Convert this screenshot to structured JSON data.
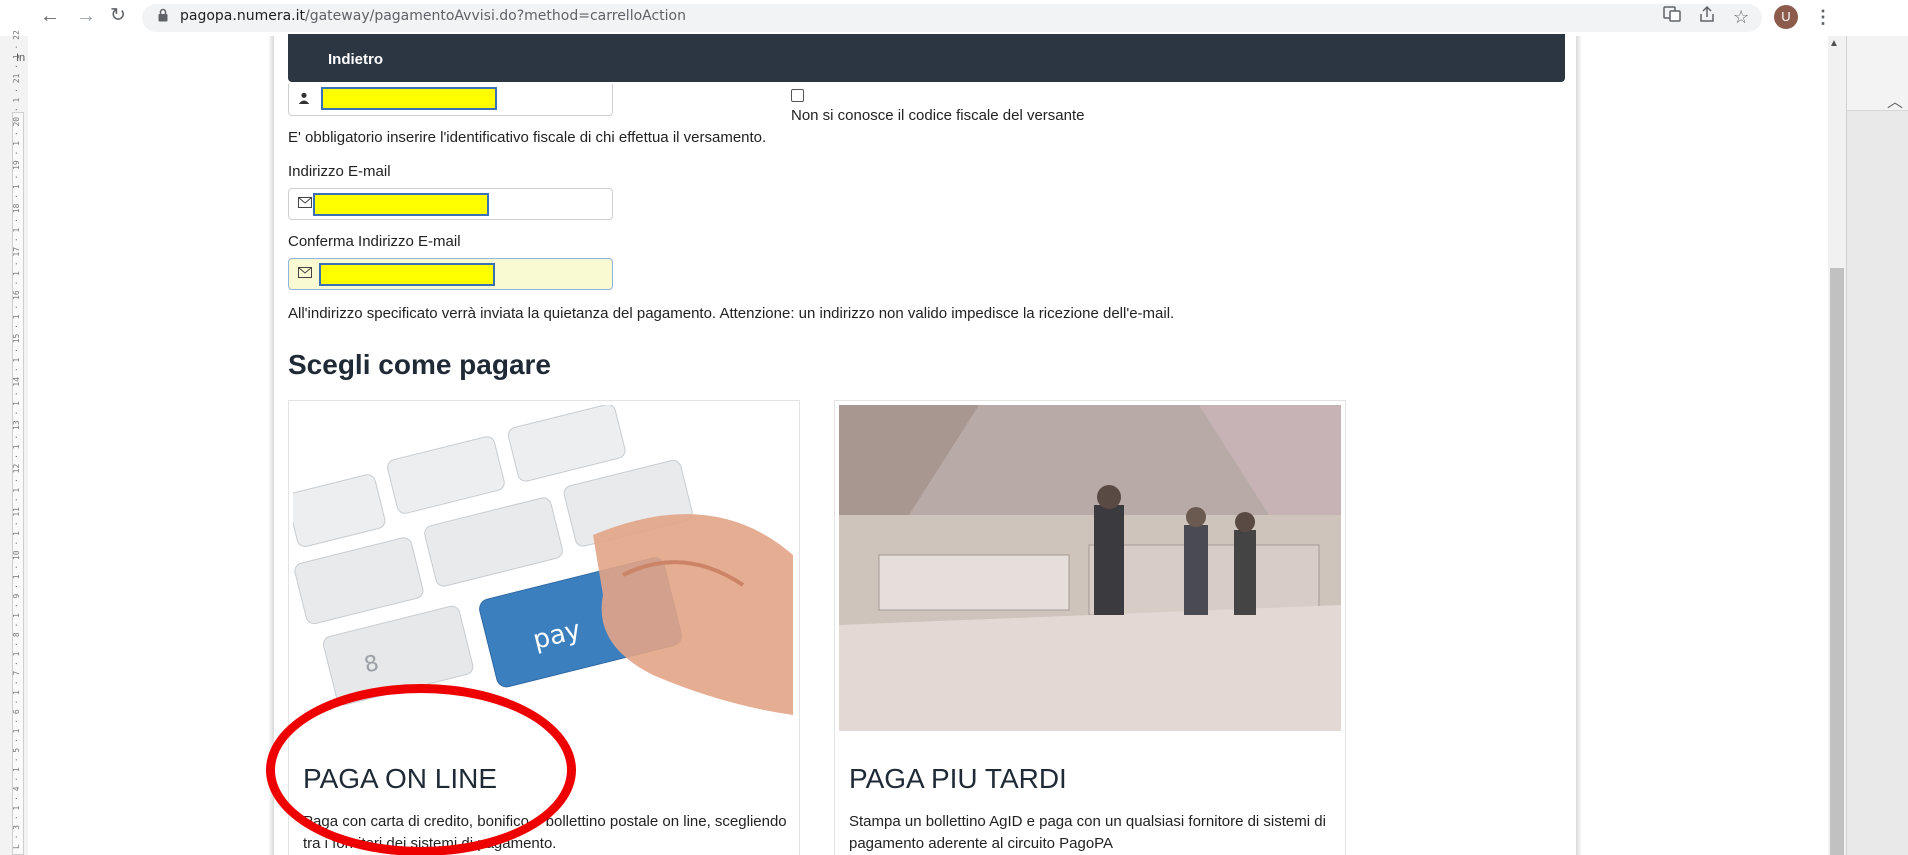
{
  "browser": {
    "url_host": "pagopa.numera.it",
    "url_path": "/gateway/pagamentoAvvisi.do?method=carrelloAction",
    "avatar_letter": "U",
    "icons": [
      "back-arrow-icon",
      "forward-arrow-icon",
      "reload-icon",
      "lock-icon",
      "translate-icon",
      "share-icon",
      "star-icon",
      "menu-dots-icon"
    ]
  },
  "background": {
    "left_fragment": "In",
    "ruler_text": "L · 3 · 1 · 4 · 1 · 5 · 1 · 6 · 1 · 7 · 1 · 8 · 1 · 9 · 1 · 10 · 1 · 11 · 1 · 12 · 1 · 13 · 1 · 14 · 1 · 15 · 1 · 16 · 1 · 17 · 1 · 18 · 1 · 19 · 1 · 20 · 1 · 21 · 1 · 22"
  },
  "nav": {
    "back_label": "Indietro"
  },
  "form": {
    "cf_checkbox_label": "Non si conosce il codice fiscale del versante",
    "cf_required_note": "E' obbligatorio inserire l'identificativo fiscale di chi effettua il versamento.",
    "email_label": "Indirizzo E-mail",
    "confirm_email_label": "Conferma Indirizzo E-mail",
    "email_note": "All'indirizzo specificato verrà inviata la quietanza del pagamento. Attenzione: un indirizzo non valido impedisce la ricezione dell'e-mail."
  },
  "payment": {
    "heading": "Scegli come pagare",
    "options": [
      {
        "title": "PAGA ON LINE",
        "description": "Paga con carta di credito, bonifico o bollettino postale on line, scegliendo tra i fornitori dei sistemi di pagamento.",
        "image_key_label": "pay"
      },
      {
        "title": "PAGA PIU TARDI",
        "description": "Stampa un bollettino AgID e paga con un qualsiasi fornitore di sistemi di pagamento aderente al circuito PagoPA"
      }
    ]
  },
  "colors": {
    "nav_bg": "#2c3643",
    "highlight_yellow": "#ffff00",
    "annotation_red": "#ee0000",
    "pay_key_blue": "#3c7fbf"
  }
}
